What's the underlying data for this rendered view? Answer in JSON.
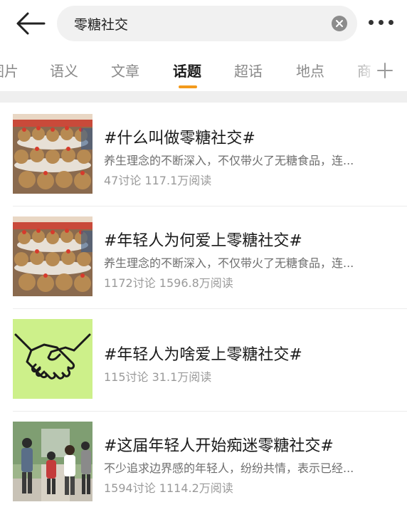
{
  "search": {
    "query": "零糖社交",
    "clear_icon": "clear-icon"
  },
  "tabs": [
    {
      "label": "图片",
      "active": false
    },
    {
      "label": "语义",
      "active": false
    },
    {
      "label": "文章",
      "active": false
    },
    {
      "label": "话题",
      "active": true
    },
    {
      "label": "超话",
      "active": false
    },
    {
      "label": "地点",
      "active": false
    },
    {
      "label": "商",
      "active": false
    }
  ],
  "accent_color": "#f39a1c",
  "topics": [
    {
      "title": "#什么叫做零糖社交#",
      "desc": "养生理念的不断深入，不仅带火了无糖食品，连...",
      "stats": "47讨论 117.1万阅读",
      "thumb": "plush-toys-photo"
    },
    {
      "title": "#年轻人为何爱上零糖社交#",
      "desc": "养生理念的不断深入，不仅带火了无糖食品，连...",
      "stats": "1172讨论 1596.8万阅读",
      "thumb": "plush-toys-photo"
    },
    {
      "title": "#年轻人为啥爱上零糖社交#",
      "desc": "",
      "stats": "115讨论 31.1万阅读",
      "thumb": "handshake-illustration"
    },
    {
      "title": "#这届年轻人开始痴迷零糖社交#",
      "desc": "不少追求边界感的年轻人，纷纷共情，表示已经...",
      "stats": "1594讨论 1114.2万阅读",
      "thumb": "people-outdoor-photo"
    }
  ]
}
